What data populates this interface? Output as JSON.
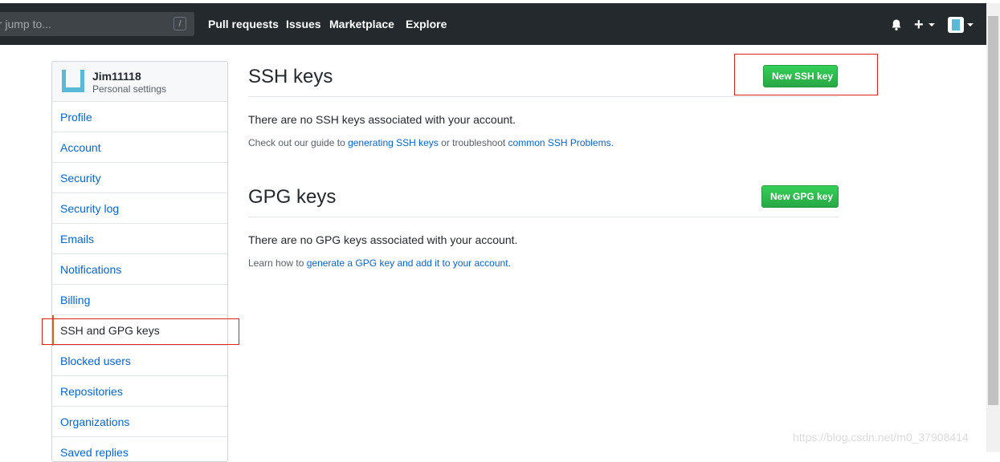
{
  "header": {
    "search_placeholder": "or jump to...",
    "slash_key": "/",
    "nav": [
      "Pull requests",
      "Issues",
      "Marketplace",
      "Explore"
    ],
    "plus": "+"
  },
  "sidebar": {
    "username": "Jim11118",
    "subtitle": "Personal settings",
    "items": [
      {
        "label": "Profile"
      },
      {
        "label": "Account"
      },
      {
        "label": "Security"
      },
      {
        "label": "Security log"
      },
      {
        "label": "Emails"
      },
      {
        "label": "Notifications"
      },
      {
        "label": "Billing"
      },
      {
        "label": "SSH and GPG keys",
        "active": true
      },
      {
        "label": "Blocked users"
      },
      {
        "label": "Repositories"
      },
      {
        "label": "Organizations"
      },
      {
        "label": "Saved replies"
      }
    ]
  },
  "ssh": {
    "title": "SSH keys",
    "button": "New SSH key",
    "blank": "There are no SSH keys associated with your account.",
    "note_prefix": "Check out our guide to ",
    "note_link1": "generating SSH keys",
    "note_mid": " or troubleshoot ",
    "note_link2": "common SSH Problems",
    "note_suffix": "."
  },
  "gpg": {
    "title": "GPG keys",
    "button": "New GPG key",
    "blank": "There are no GPG keys associated with your account.",
    "note_prefix": "Learn how to ",
    "note_link": "generate a GPG key and add it to your account",
    "note_suffix": "."
  },
  "watermark": "https://blog.csdn.net/m0_37908414",
  "colors": {
    "header_bg": "#24292e",
    "link": "#0366d6",
    "button_green": "#28a745",
    "annotation_red": "#e2231a",
    "active_border": "#e36209"
  }
}
